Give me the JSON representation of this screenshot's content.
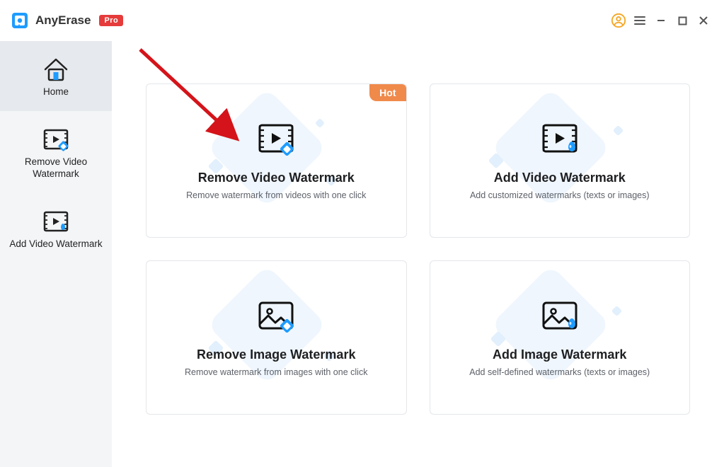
{
  "titlebar": {
    "app_name": "AnyErase",
    "pro_label": "Pro"
  },
  "sidebar": {
    "items": [
      {
        "label": "Home"
      },
      {
        "label": "Remove Video Watermark"
      },
      {
        "label": "Add Video Watermark"
      }
    ]
  },
  "main": {
    "hot_label": "Hot",
    "cards": [
      {
        "title": "Remove Video Watermark",
        "subtitle": "Remove watermark from videos with one click"
      },
      {
        "title": "Add Video Watermark",
        "subtitle": "Add customized watermarks (texts or images)"
      },
      {
        "title": "Remove Image Watermark",
        "subtitle": "Remove watermark from images with one click"
      },
      {
        "title": "Add Image Watermark",
        "subtitle": "Add self-defined watermarks  (texts or images)"
      }
    ]
  }
}
